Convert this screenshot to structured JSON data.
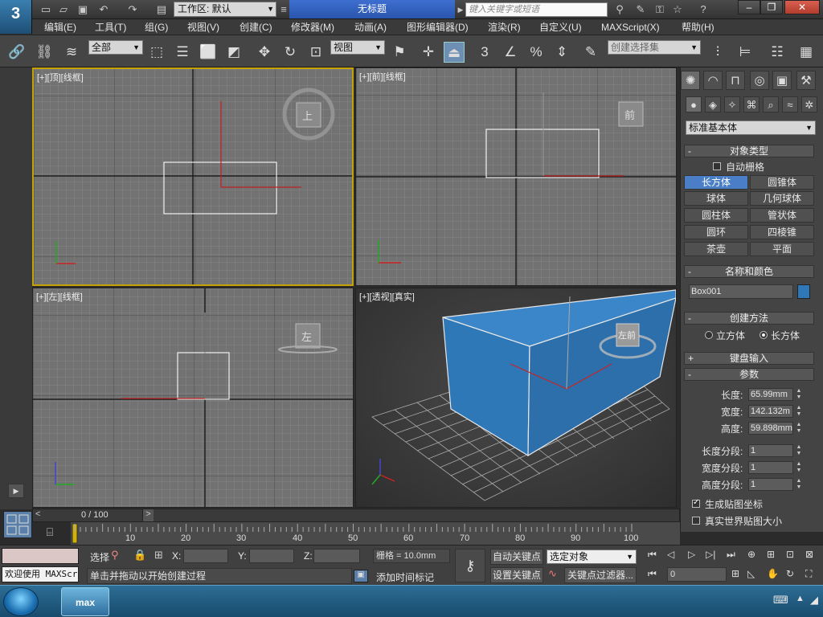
{
  "titlebar": {
    "app_logo": "3",
    "workspace_label": "工作区: 默认",
    "document_title": "无标题",
    "search_placeholder": "键入关键字或短语"
  },
  "menu": [
    "编辑(E)",
    "工具(T)",
    "组(G)",
    "视图(V)",
    "创建(C)",
    "修改器(M)",
    "动画(A)",
    "图形编辑器(D)",
    "渲染(R)",
    "自定义(U)",
    "MAXScript(X)",
    "帮助(H)"
  ],
  "toolbar": {
    "selection_filter": "全部",
    "ref_coord": "视图",
    "snap_value": "3",
    "named_selection_placeholder": "创建选择集"
  },
  "viewports": {
    "top": {
      "label": "[+][顶][线框]",
      "cube_label": "上"
    },
    "front": {
      "label": "[+][前][线框]",
      "cube_label": "前"
    },
    "left": {
      "label": "[+][左][线框]",
      "cube_label": "左"
    },
    "perspective": {
      "label": "[+][透视][真实]",
      "cube_label": "左前"
    }
  },
  "panel": {
    "category": "标准基本体",
    "object_type": {
      "title": "对象类型",
      "autogrid": "自动栅格",
      "buttons": [
        "长方体",
        "圆锥体",
        "球体",
        "几何球体",
        "圆柱体",
        "管状体",
        "圆环",
        "四棱锥",
        "茶壶",
        "平面"
      ]
    },
    "name_color": {
      "title": "名称和颜色",
      "name": "Box001",
      "color": "#2f78b8"
    },
    "creation_method": {
      "title": "创建方法",
      "cube": "立方体",
      "box": "长方体"
    },
    "keyboard_entry": {
      "title": "键盘输入"
    },
    "params": {
      "title": "参数",
      "length_label": "长度:",
      "length": "65.99mm",
      "width_label": "宽度:",
      "width": "142.132m",
      "height_label": "高度:",
      "height": "59.898mm",
      "lseg_label": "长度分段:",
      "lseg": "1",
      "wseg_label": "宽度分段:",
      "wseg": "1",
      "hseg_label": "高度分段:",
      "hseg": "1",
      "gen_map": "生成贴图坐标",
      "real_world": "真实世界贴图大小"
    }
  },
  "timeline": {
    "frame_display": "0 / 100",
    "ticks": [
      "10",
      "20",
      "30",
      "40",
      "50",
      "60",
      "70",
      "80",
      "90",
      "100"
    ]
  },
  "status": {
    "welcome": "欢迎使用 MAXScr",
    "selected": "选择",
    "x_label": "X:",
    "y_label": "Y:",
    "z_label": "Z:",
    "grid": "栅格 = 10.0mm",
    "prompt": "单击并拖动以开始创建过程",
    "add_time_tag": "添加时间标记",
    "auto_key": "自动关键点",
    "set_key": "设置关键点",
    "key_mode": "选定对象",
    "key_filters": "关键点过滤器...",
    "current_frame": "0"
  },
  "taskbar": {
    "app": "max"
  }
}
